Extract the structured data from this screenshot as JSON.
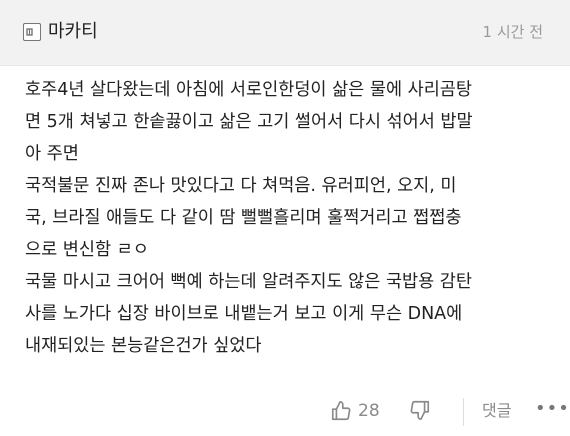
{
  "header": {
    "username": "마카티",
    "timestamp": "1 시간 전"
  },
  "comment": {
    "lines": [
      "호주4년 살다왔는데 아침에 서로인한덩이 삶은 물에 사리곰탕",
      "면 5개 쳐넣고 한솥끓이고 삶은 고기 썰어서 다시 섞어서 밥말",
      "아 주면",
      "국적불문 진짜 존나 맛있다고 다 쳐먹음. 유러피언, 오지, 미",
      "국, 브라질 애들도 다 같이 땀 뻘뻘흘리며 훌쩍거리고 쩝쩝충",
      "으로 변신함 ㄹㅇ",
      "국물 마시고 크어어 뻑예 하는데 알려주지도 않은 국밥용 감탄",
      "사를 노가다 십장 바이브로 내뱉는거 보고 이게 무슨 DNA에",
      "내재되있는 본능같은건가 싶었다"
    ]
  },
  "footer": {
    "like_count": "28",
    "reply_label": "댓글",
    "more_label": "•••"
  },
  "icons": {
    "avatar": "profile-card-icon",
    "like": "thumbs-up-icon",
    "dislike": "thumbs-down-icon",
    "more": "more-dots-icon"
  },
  "colors": {
    "header_bg": "#f2f2f2",
    "text": "#222222",
    "muted": "#9a9a9a"
  }
}
